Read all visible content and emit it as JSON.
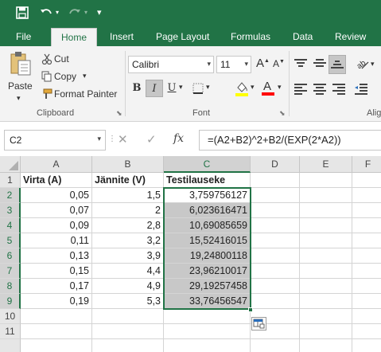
{
  "ribbon_tabs": [
    "File",
    "Home",
    "Insert",
    "Page Layout",
    "Formulas",
    "Data",
    "Review"
  ],
  "clipboard": {
    "paste": "Paste",
    "cut": "Cut",
    "copy": "Copy",
    "format_painter": "Format Painter",
    "label": "Clipboard"
  },
  "font": {
    "name": "Calibri",
    "size": "11",
    "bold": "B",
    "italic": "I",
    "underline": "U",
    "font_color_glyph": "A",
    "label": "Font"
  },
  "alignment": {
    "label": "Alig"
  },
  "formula_bar": {
    "name_box": "C2",
    "fx": "fx",
    "formula": "=(A2+B2)^2+B2/(EXP(2*A2))"
  },
  "columns": [
    "A",
    "B",
    "C",
    "D",
    "E",
    "F"
  ],
  "rows": [
    "1",
    "2",
    "3",
    "4",
    "5",
    "6",
    "7",
    "8",
    "9",
    "10",
    "11"
  ],
  "sheet": {
    "headers": [
      "Virta (A)",
      "Jännite (V)",
      "Testilauseke"
    ],
    "data": [
      [
        "0,05",
        "1,5",
        "3,759756127"
      ],
      [
        "0,07",
        "2",
        "6,023616471"
      ],
      [
        "0,09",
        "2,8",
        "10,69085659"
      ],
      [
        "0,11",
        "3,2",
        "15,52416015"
      ],
      [
        "0,13",
        "3,9",
        "19,24800118"
      ],
      [
        "0,15",
        "4,4",
        "23,96210017"
      ],
      [
        "0,17",
        "4,9",
        "29,19257458"
      ],
      [
        "0,19",
        "5,3",
        "33,76456547"
      ]
    ]
  },
  "colors": {
    "excel_green": "#217346",
    "selection_shade": "#c8c8c8"
  }
}
